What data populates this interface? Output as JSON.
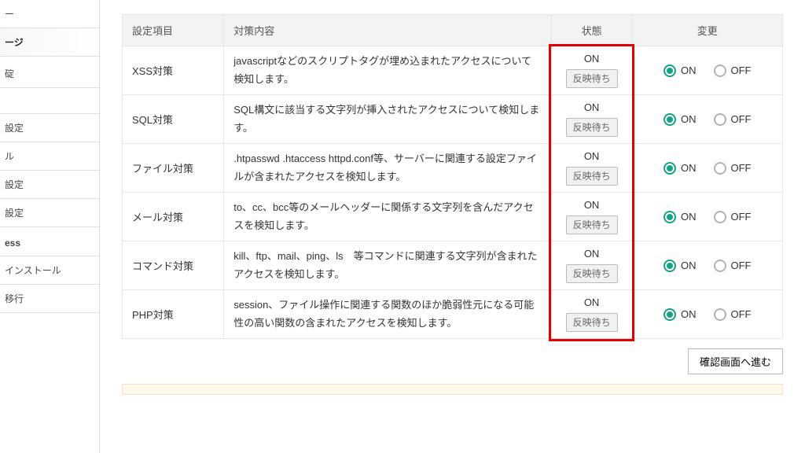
{
  "sidebar": {
    "items": [
      {
        "label": "ー"
      },
      {
        "label": "ージ",
        "active": true
      },
      {
        "label": "碇"
      },
      {
        "label": ""
      },
      {
        "label": "設定"
      },
      {
        "label": "ル"
      },
      {
        "label": "設定"
      },
      {
        "label": "設定"
      },
      {
        "label": "ess",
        "bold": true
      },
      {
        "label": "インストール"
      },
      {
        "label": "移行"
      }
    ]
  },
  "table": {
    "headers": {
      "item": "設定項目",
      "detail": "対策内容",
      "state": "状態",
      "change": "変更"
    },
    "badge": "反映待ち",
    "rows": [
      {
        "name": "XSS対策",
        "desc": "javascriptなどのスクリプトタグが埋め込まれたアクセスについて検知します。",
        "status": "ON",
        "selected": "on"
      },
      {
        "name": "SQL対策",
        "desc": "SQL構文に該当する文字列が挿入されたアクセスについて検知します。",
        "status": "ON",
        "selected": "on"
      },
      {
        "name": "ファイル対策",
        "desc": ".htpasswd .htaccess httpd.conf等、サーバーに関連する設定ファイルが含まれたアクセスを検知します。",
        "status": "ON",
        "selected": "on"
      },
      {
        "name": "メール対策",
        "desc": "to、cc、bcc等のメールヘッダーに関係する文字列を含んだアクセスを検知します。",
        "status": "ON",
        "selected": "on"
      },
      {
        "name": "コマンド対策",
        "desc": "kill、ftp、mail、ping、ls　等コマンドに関連する文字列が含まれたアクセスを検知します。",
        "status": "ON",
        "selected": "on"
      },
      {
        "name": "PHP対策",
        "desc": "session、ファイル操作に関連する関数のほか脆弱性元になる可能性の高い関数の含まれたアクセスを検知します。",
        "status": "ON",
        "selected": "on"
      }
    ],
    "radio_labels": {
      "on": "ON",
      "off": "OFF"
    }
  },
  "proceed_btn": "確認画面へ進む"
}
